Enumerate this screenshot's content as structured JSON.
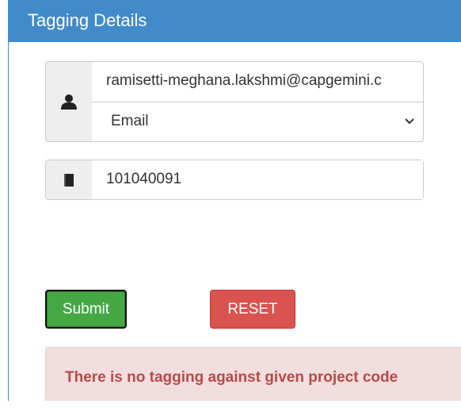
{
  "panel": {
    "title": "Tagging Details"
  },
  "form": {
    "identifier_value": "ramisetti-meghana.lakshmi@capgemini.c",
    "identifier_type_selected": "Email",
    "project_code_value": "101040091",
    "submit_label": "Submit",
    "reset_label": "RESET"
  },
  "alert": {
    "message": "There is no tagging against given project code"
  },
  "icons": {
    "user": "user-icon",
    "book": "book-icon",
    "chevron": "chevron-down-icon"
  },
  "colors": {
    "header": "#428bca",
    "submit": "#45a845",
    "reset": "#d9534f",
    "alert_bg": "#f2dede",
    "alert_text": "#b94a48"
  }
}
